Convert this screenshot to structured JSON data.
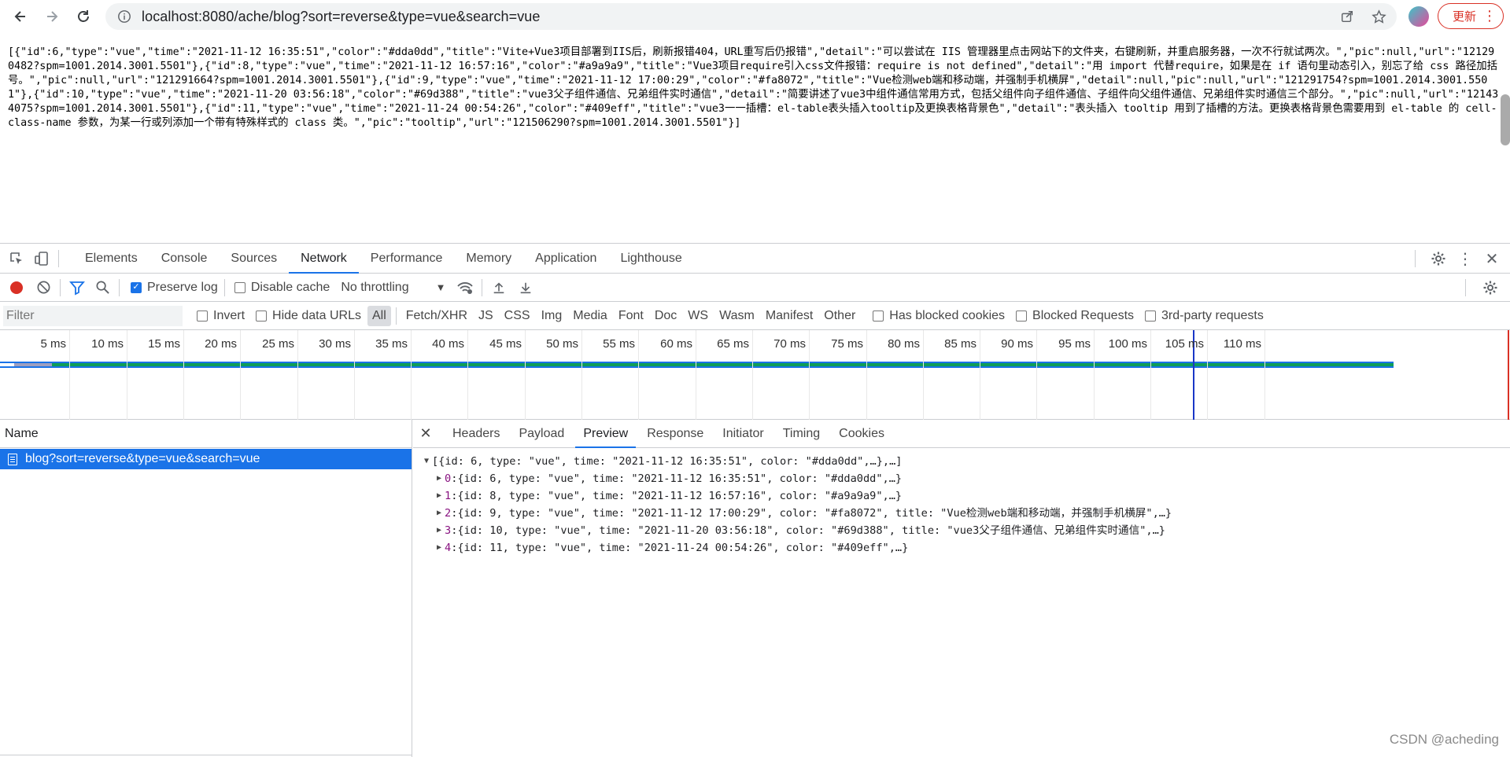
{
  "browser": {
    "url": "localhost:8080/ache/blog?sort=reverse&type=vue&search=vue",
    "update_label": "更新",
    "icons": {
      "back": "arrow-left-icon",
      "forward": "arrow-right-icon",
      "reload": "reload-icon",
      "info": "info-icon",
      "share": "share-icon",
      "bookmark": "star-icon",
      "menu": "kebab-menu-icon"
    }
  },
  "page": {
    "raw_json": "[{\"id\":6,\"type\":\"vue\",\"time\":\"2021-11-12 16:35:51\",\"color\":\"#dda0dd\",\"title\":\"Vite+Vue3项目部署到IIS后，刷新报错404，URL重写后仍报错\",\"detail\":\"可以尝试在 IIS 管理器里点击网站下的文件夹，右键刷新，并重启服务器，一次不行就试两次。\",\"pic\":null,\"url\":\"121290482?spm=1001.2014.3001.5501\"},{\"id\":8,\"type\":\"vue\",\"time\":\"2021-11-12 16:57:16\",\"color\":\"#a9a9a9\",\"title\":\"Vue3项目require引入css文件报错：require is not defined\",\"detail\":\"用 import 代替require，如果是在 if 语句里动态引入，别忘了给 css 路径加括号。\",\"pic\":null,\"url\":\"121291664?spm=1001.2014.3001.5501\"},{\"id\":9,\"type\":\"vue\",\"time\":\"2021-11-12 17:00:29\",\"color\":\"#fa8072\",\"title\":\"Vue检测web端和移动端，并强制手机横屏\",\"detail\":null,\"pic\":null,\"url\":\"121291754?spm=1001.2014.3001.5501\"},{\"id\":10,\"type\":\"vue\",\"time\":\"2021-11-20 03:56:18\",\"color\":\"#69d388\",\"title\":\"vue3父子组件通信、兄弟组件实时通信\",\"detail\":\"简要讲述了vue3中组件通信常用方式，包括父组件向子组件通信、子组件向父组件通信、兄弟组件实时通信三个部分。\",\"pic\":null,\"url\":\"121434075?spm=1001.2014.3001.5501\"},{\"id\":11,\"type\":\"vue\",\"time\":\"2021-11-24 00:54:26\",\"color\":\"#409eff\",\"title\":\"vue3一一插槽：el-table表头插入tooltip及更换表格背景色\",\"detail\":\"表头插入 tooltip 用到了插槽的方法。更换表格背景色需要用到 el-table 的 cell-class-name 参数，为某一行或列添加一个带有特殊样式的 class 类。\",\"pic\":\"tooltip\",\"url\":\"121506290?spm=1001.2014.3001.5501\"}]"
  },
  "devtools": {
    "tabs": [
      "Elements",
      "Console",
      "Sources",
      "Network",
      "Performance",
      "Memory",
      "Application",
      "Lighthouse"
    ],
    "active_tab": "Network",
    "controls": {
      "preserve_log": "Preserve log",
      "preserve_log_checked": true,
      "disable_cache": "Disable cache",
      "disable_cache_checked": false,
      "throttling": "No throttling"
    },
    "filter": {
      "placeholder": "Filter",
      "invert": "Invert",
      "hide_data_urls": "Hide data URLs",
      "types": [
        "All",
        "Fetch/XHR",
        "JS",
        "CSS",
        "Img",
        "Media",
        "Font",
        "Doc",
        "WS",
        "Wasm",
        "Manifest",
        "Other"
      ],
      "active_type": "All",
      "has_blocked_cookies": "Has blocked cookies",
      "blocked_requests": "Blocked Requests",
      "third_party": "3rd-party requests"
    },
    "timeline": {
      "ticks": [
        "5 ms",
        "10 ms",
        "15 ms",
        "20 ms",
        "25 ms",
        "30 ms",
        "35 ms",
        "40 ms",
        "45 ms",
        "50 ms",
        "55 ms",
        "60 ms",
        "65 ms",
        "70 ms",
        "75 ms",
        "80 ms",
        "85 ms",
        "90 ms",
        "95 ms",
        "100 ms",
        "105 ms",
        "110 ms"
      ]
    },
    "requests": {
      "header": "Name",
      "items": [
        {
          "name": "blog?sort=reverse&type=vue&search=vue"
        }
      ]
    },
    "detail_tabs": [
      "Headers",
      "Payload",
      "Preview",
      "Response",
      "Initiator",
      "Timing",
      "Cookies"
    ],
    "active_detail_tab": "Preview",
    "preview": {
      "root": "[{id: 6, type: \"vue\", time: \"2021-11-12 16:35:51\", color: \"#dda0dd\",…},…]",
      "items": [
        {
          "idx": "0",
          "text": "{id: 6, type: \"vue\", time: \"2021-11-12 16:35:51\", color: \"#dda0dd\",…}"
        },
        {
          "idx": "1",
          "text": "{id: 8, type: \"vue\", time: \"2021-11-12 16:57:16\", color: \"#a9a9a9\",…}"
        },
        {
          "idx": "2",
          "text": "{id: 9, type: \"vue\", time: \"2021-11-12 17:00:29\", color: \"#fa8072\", title: \"Vue检测web端和移动端，并强制手机横屏\",…}"
        },
        {
          "idx": "3",
          "text": "{id: 10, type: \"vue\", time: \"2021-11-20 03:56:18\", color: \"#69d388\", title: \"vue3父子组件通信、兄弟组件实时通信\",…}"
        },
        {
          "idx": "4",
          "text": "{id: 11, type: \"vue\", time: \"2021-11-24 00:54:26\", color: \"#409eff\",…}"
        }
      ]
    }
  },
  "watermark": "CSDN @acheding"
}
